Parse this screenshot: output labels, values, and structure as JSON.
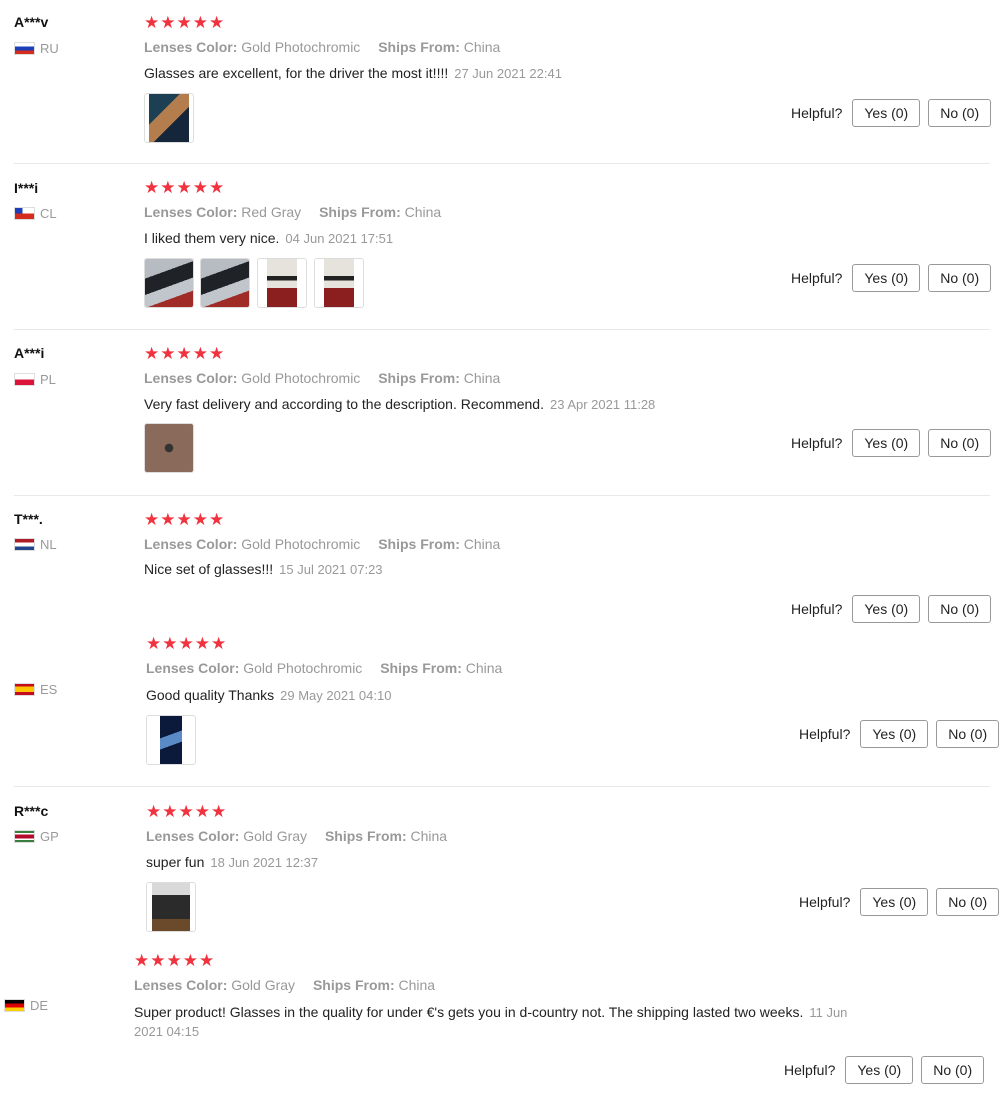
{
  "helpful_label": "Helpful?",
  "rating_stars": "★★★★★",
  "attr_labels": {
    "lenses": "Lenses Color:",
    "ships": "Ships From:"
  },
  "reviews": [
    {
      "user": "A***v",
      "country": "RU",
      "rating": 5,
      "lenses_color": "Gold Photochromic",
      "ships_from": "China",
      "text": "Glasses are excellent, for the driver the most it!!!!",
      "date": "27 Jun 2021 22:41",
      "yes": "Yes (0)",
      "no": "No (0)"
    },
    {
      "user": "I***i",
      "country": "CL",
      "rating": 5,
      "lenses_color": "Red Gray",
      "ships_from": "China",
      "text": "I liked them very nice.",
      "date": "04 Jun 2021 17:51",
      "yes": "Yes (0)",
      "no": "No (0)"
    },
    {
      "user": "A***i",
      "country": "PL",
      "rating": 5,
      "lenses_color": "Gold Photochromic",
      "ships_from": "China",
      "text": "Very fast delivery and according to the description. Recommend.",
      "date": "23 Apr 2021 11:28",
      "yes": "Yes (0)",
      "no": "No (0)"
    },
    {
      "user": "T***.",
      "country": "NL",
      "rating": 5,
      "lenses_color": "Gold Photochromic",
      "ships_from": "China",
      "text": "Nice set of glasses!!!",
      "date": "15 Jul 2021 07:23",
      "yes": "Yes (0)",
      "no": "No (0)"
    },
    {
      "user": "",
      "country": "ES",
      "rating": 5,
      "lenses_color": "Gold Photochromic",
      "ships_from": "China",
      "text": "Good quality Thanks",
      "date": "29 May 2021 04:10",
      "yes": "Yes (0)",
      "no": "No (0)"
    },
    {
      "user": "R***c",
      "country": "GP",
      "rating": 5,
      "lenses_color": "Gold Gray",
      "ships_from": "China",
      "text": "super fun",
      "date": "18 Jun 2021 12:37",
      "yes": "Yes (0)",
      "no": "No (0)"
    },
    {
      "user": "",
      "country": "DE",
      "rating": 5,
      "lenses_color": "Gold Gray",
      "ships_from": "China",
      "text": "Super product! Glasses in the quality for under €'s gets you in d-country not. The shipping lasted two weeks.",
      "date": "11 Jun 2021 04:15",
      "yes": "Yes (0)",
      "no": "No (0)"
    }
  ]
}
